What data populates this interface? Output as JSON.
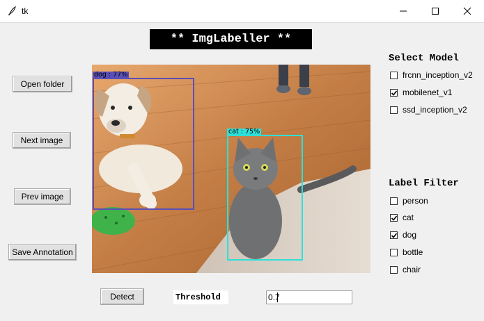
{
  "window": {
    "title": "tk",
    "minimize_icon": "minimize-icon",
    "maximize_icon": "maximize-icon",
    "close_icon": "close-icon"
  },
  "banner": {
    "text": "** ImgLabeller **"
  },
  "buttons": {
    "open_folder": "Open folder",
    "next_image": "Next image",
    "prev_image": "Prev image",
    "save_annotation": "Save Annotation",
    "detect": "Detect"
  },
  "image": {
    "detections": [
      {
        "label": "dog : 77%",
        "color": "#5a4fb8"
      },
      {
        "label": "cat : 75%",
        "color": "#2ee0d8"
      }
    ]
  },
  "select_model": {
    "title": "Select Model",
    "options": [
      {
        "label": "frcnn_inception_v2",
        "checked": false
      },
      {
        "label": "mobilenet_v1",
        "checked": true
      },
      {
        "label": "ssd_inception_v2",
        "checked": false
      }
    ]
  },
  "label_filter": {
    "title": "Label Filter",
    "options": [
      {
        "label": "person",
        "checked": false
      },
      {
        "label": "cat",
        "checked": true
      },
      {
        "label": "dog",
        "checked": true
      },
      {
        "label": "bottle",
        "checked": false
      },
      {
        "label": "chair",
        "checked": false
      }
    ]
  },
  "threshold": {
    "label": "Threshold",
    "value": "0.7"
  }
}
